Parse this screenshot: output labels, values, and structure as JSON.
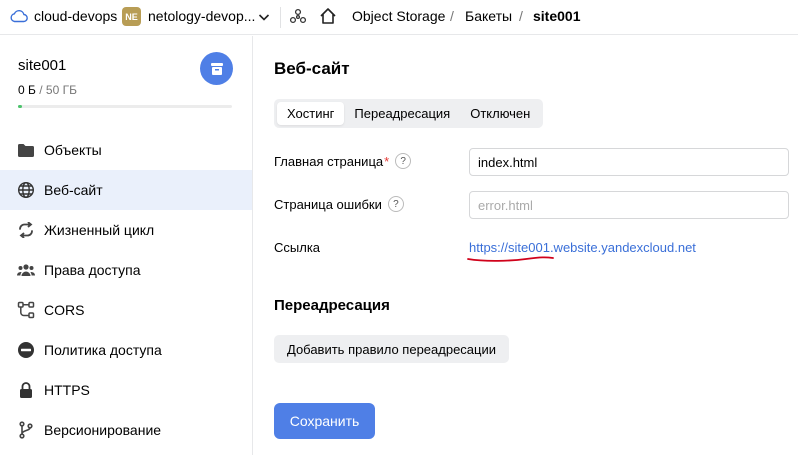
{
  "topbar": {
    "cloud_label": "cloud-devops",
    "folder_badge": "NE",
    "folder_label": "netology-devop...",
    "breadcrumbs": [
      "Object Storage",
      "Бакеты",
      "site001"
    ]
  },
  "sidebar": {
    "bucket_name": "site001",
    "usage_used": "0 Б",
    "usage_total": " / 50 ГБ",
    "usage_fraction": 0.0,
    "items": [
      {
        "label": "Объекты",
        "icon": "folder-icon"
      },
      {
        "label": "Веб-сайт",
        "icon": "globe-icon",
        "active": true
      },
      {
        "label": "Жизненный цикл",
        "icon": "lifecycle-icon"
      },
      {
        "label": "Права доступа",
        "icon": "users-icon"
      },
      {
        "label": "CORS",
        "icon": "cors-icon"
      },
      {
        "label": "Политика доступа",
        "icon": "policy-icon"
      },
      {
        "label": "HTTPS",
        "icon": "lock-icon"
      },
      {
        "label": "Версионирование",
        "icon": "versioning-icon"
      }
    ]
  },
  "main": {
    "title": "Веб-сайт",
    "tabs": [
      {
        "label": "Хостинг",
        "active": true
      },
      {
        "label": "Переадресация"
      },
      {
        "label": "Отключен"
      }
    ],
    "form": {
      "index_label": "Главная страница",
      "index_value": "index.html",
      "error_label": "Страница ошибки",
      "error_placeholder": "error.html",
      "link_label": "Ссылка",
      "link_value": "https://site001.website.yandexcloud.net"
    },
    "redirect_title": "Переадресация",
    "add_rule_label": "Добавить правило переадресации",
    "save_label": "Сохранить"
  },
  "colors": {
    "accent": "#4f7fe6",
    "active_nav": "#eaf0fb",
    "link": "#3a6fd8",
    "badge": "#b89d55",
    "annotation": "#d0021b"
  }
}
